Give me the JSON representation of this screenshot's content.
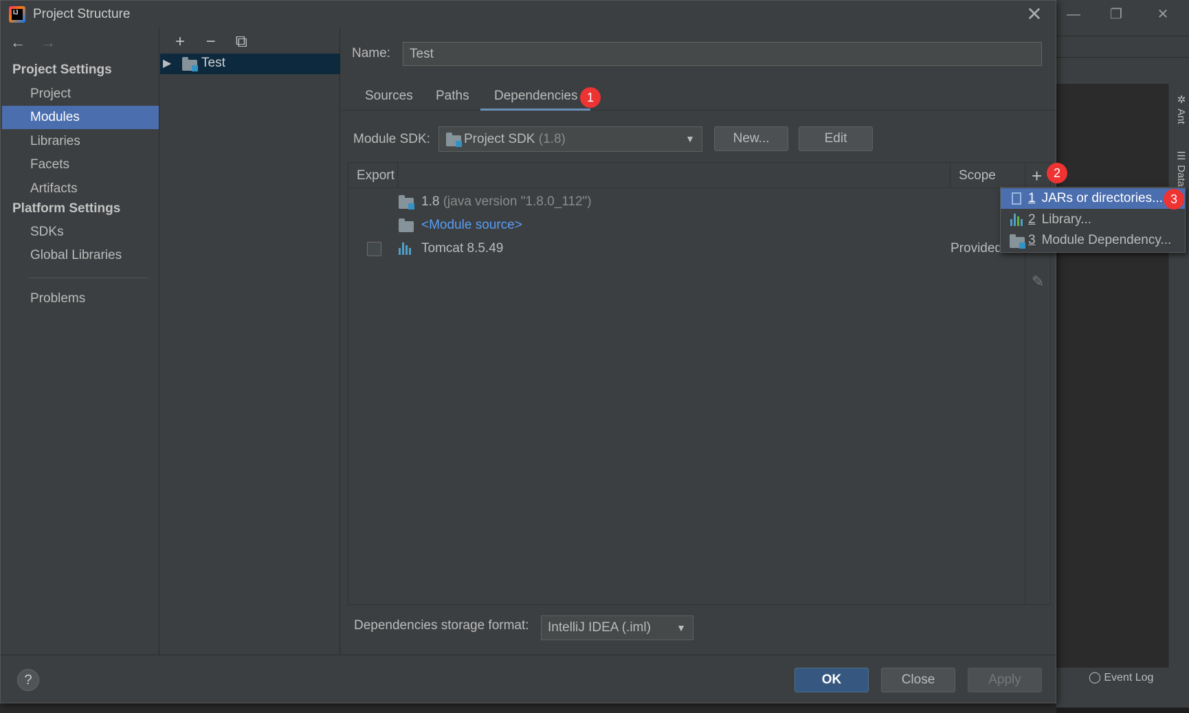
{
  "dialog": {
    "title": "Project Structure",
    "close_icon": "close-icon"
  },
  "nav": {
    "back_arrow": "←",
    "forward_arrow": "→",
    "project_settings_header": "Project Settings",
    "project_items": [
      "Project",
      "Modules",
      "Libraries",
      "Facets",
      "Artifacts"
    ],
    "platform_settings_header": "Platform Settings",
    "platform_items": [
      "SDKs",
      "Global Libraries"
    ],
    "problems": "Problems",
    "selected": "Modules"
  },
  "tree": {
    "add": "+",
    "remove": "−",
    "copy": "⧉",
    "module_name": "Test"
  },
  "module": {
    "name_label": "Name:",
    "name_value": "Test",
    "tabs": [
      "Sources",
      "Paths",
      "Dependencies"
    ],
    "active_tab": "Dependencies",
    "sdk_label": "Module SDK:",
    "sdk_value": "Project SDK",
    "sdk_version": "(1.8)",
    "new_button": "New...",
    "edit_button": "Edit"
  },
  "dependencies": {
    "col_export": "Export",
    "col_scope": "Scope",
    "rows": [
      {
        "name": "1.8",
        "detail": "(java version \"1.8.0_112\")",
        "scope": ""
      },
      {
        "name": "<Module source>",
        "detail": "",
        "scope": ""
      },
      {
        "name": "Tomcat 8.5.49",
        "detail": "",
        "scope": "Provided"
      }
    ],
    "storage_label": "Dependencies storage format:",
    "storage_value": "IntelliJ IDEA (.iml)"
  },
  "popup": {
    "items": [
      {
        "num": "1",
        "label": "JARs or directories..."
      },
      {
        "num": "2",
        "label": "Library..."
      },
      {
        "num": "3",
        "label": "Module Dependency..."
      }
    ]
  },
  "badges": [
    "1",
    "2",
    "3"
  ],
  "footer": {
    "help": "?",
    "ok": "OK",
    "close": "Close",
    "apply": "Apply"
  },
  "background_ide": {
    "ant_tab": "Ant",
    "database_tab": "Data",
    "event_log": "Event Log"
  },
  "colors": {
    "selection": "#4b6eaf",
    "badge": "#ee3333",
    "link": "#589df6",
    "ok_button": "#365880"
  }
}
